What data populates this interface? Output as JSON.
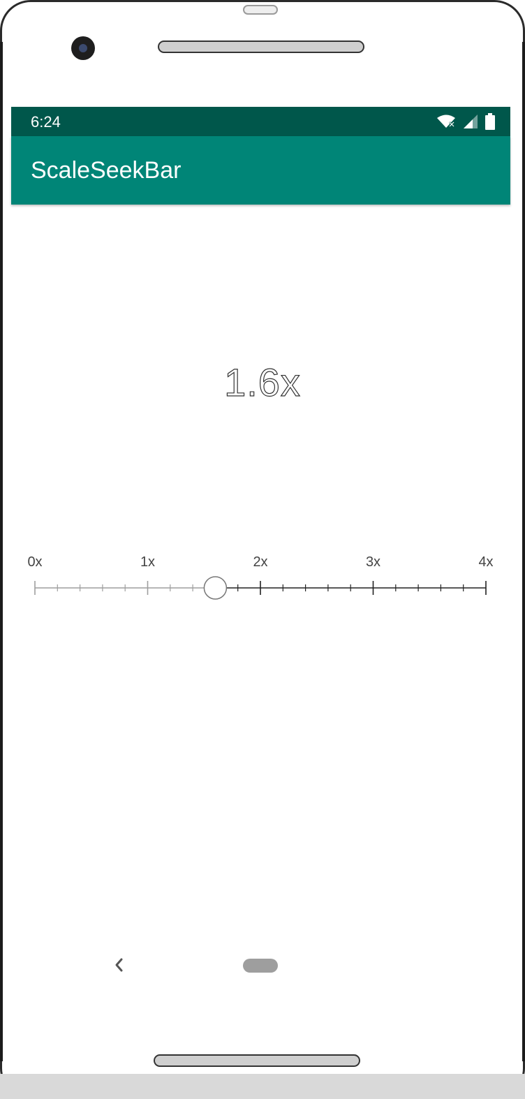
{
  "status_bar": {
    "time": "6:24"
  },
  "app_bar": {
    "title": "ScaleSeekBar"
  },
  "seekbar": {
    "value_text": "1.6x",
    "value": 1.6,
    "min": 0,
    "max": 4,
    "minor_ticks_per_unit": 5,
    "labels": [
      "0x",
      "1x",
      "2x",
      "3x",
      "4x"
    ],
    "active_color": "#222222",
    "inactive_color": "#9e9e9e"
  },
  "colors": {
    "status_bar": "#00574b",
    "app_bar": "#008577"
  },
  "nav_bar": {
    "back_icon": "back-icon",
    "home_icon": "home-pill-icon"
  }
}
